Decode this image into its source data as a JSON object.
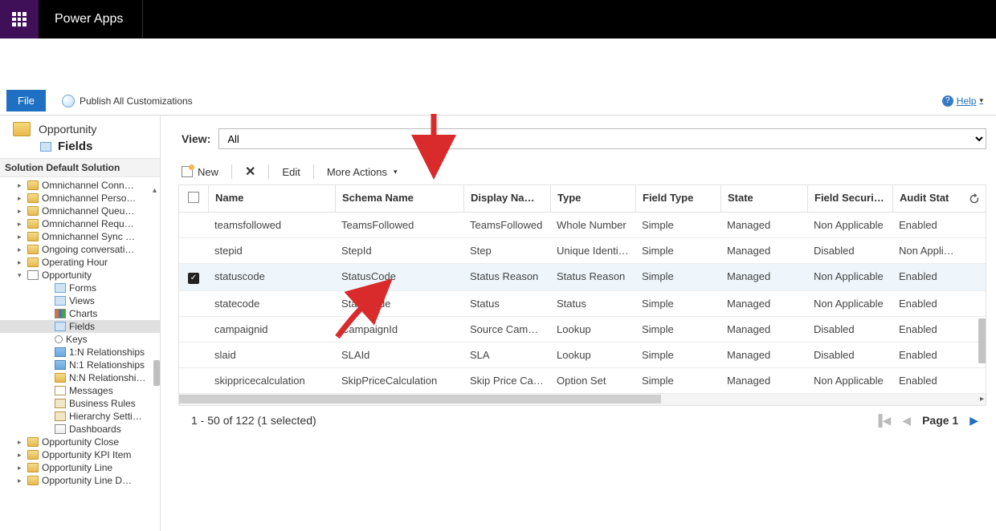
{
  "app": {
    "title": "Power Apps"
  },
  "ribbon": {
    "file_label": "File",
    "publish_label": "Publish All Customizations",
    "help_label": "Help"
  },
  "entity": {
    "title": "Opportunity",
    "section": "Fields"
  },
  "solution_header": "Solution Default Solution",
  "tree": {
    "top": [
      "Omnichannel Conn…",
      "Omnichannel Perso…",
      "Omnichannel Queu…",
      "Omnichannel Requ…",
      "Omnichannel Sync …",
      "Ongoing conversati…",
      "Operating Hour"
    ],
    "current": "Opportunity",
    "children": [
      "Forms",
      "Views",
      "Charts",
      "Fields",
      "Keys",
      "1:N Relationships",
      "N:1 Relationships",
      "N:N Relationshi…",
      "Messages",
      "Business Rules",
      "Hierarchy Setti…",
      "Dashboards"
    ],
    "below": [
      "Opportunity Close",
      "Opportunity KPI Item",
      "Opportunity Line",
      "Opportunity Line D…"
    ],
    "selected_child": "Fields"
  },
  "view": {
    "label": "View:",
    "selected": "All"
  },
  "toolbar": {
    "new_label": "New",
    "edit_label": "Edit",
    "more_label": "More Actions"
  },
  "columns": [
    "Name",
    "Schema Name",
    "Display Name…",
    "Type",
    "Field Type",
    "State",
    "Field Security…",
    "Audit Stat"
  ],
  "rows": [
    {
      "checked": false,
      "name": "teamsfollowed",
      "schema": "TeamsFollowed",
      "display": "TeamsFollowed",
      "type": "Whole Number",
      "fieldType": "Simple",
      "state": "Managed",
      "security": "Non Applicable",
      "audit": "Enabled"
    },
    {
      "checked": false,
      "name": "stepid",
      "schema": "StepId",
      "display": "Step",
      "type": "Unique Identi…",
      "fieldType": "Simple",
      "state": "Managed",
      "security": "Disabled",
      "audit": "Non Applicab"
    },
    {
      "checked": true,
      "name": "statuscode",
      "schema": "StatusCode",
      "display": "Status Reason",
      "type": "Status Reason",
      "fieldType": "Simple",
      "state": "Managed",
      "security": "Non Applicable",
      "audit": "Enabled"
    },
    {
      "checked": false,
      "name": "statecode",
      "schema": "StateCode",
      "display": "Status",
      "type": "Status",
      "fieldType": "Simple",
      "state": "Managed",
      "security": "Non Applicable",
      "audit": "Enabled"
    },
    {
      "checked": false,
      "name": "campaignid",
      "schema": "CampaignId",
      "display": "Source Camp…",
      "type": "Lookup",
      "fieldType": "Simple",
      "state": "Managed",
      "security": "Disabled",
      "audit": "Enabled"
    },
    {
      "checked": false,
      "name": "slaid",
      "schema": "SLAId",
      "display": "SLA",
      "type": "Lookup",
      "fieldType": "Simple",
      "state": "Managed",
      "security": "Disabled",
      "audit": "Enabled"
    },
    {
      "checked": false,
      "name": "skippricecalculation",
      "schema": "SkipPriceCalculation",
      "display": "Skip Price Cal…",
      "type": "Option Set",
      "fieldType": "Simple",
      "state": "Managed",
      "security": "Non Applicable",
      "audit": "Enabled"
    }
  ],
  "footer": {
    "status": "1 - 50 of 122 (1 selected)",
    "page_label": "Page 1"
  }
}
